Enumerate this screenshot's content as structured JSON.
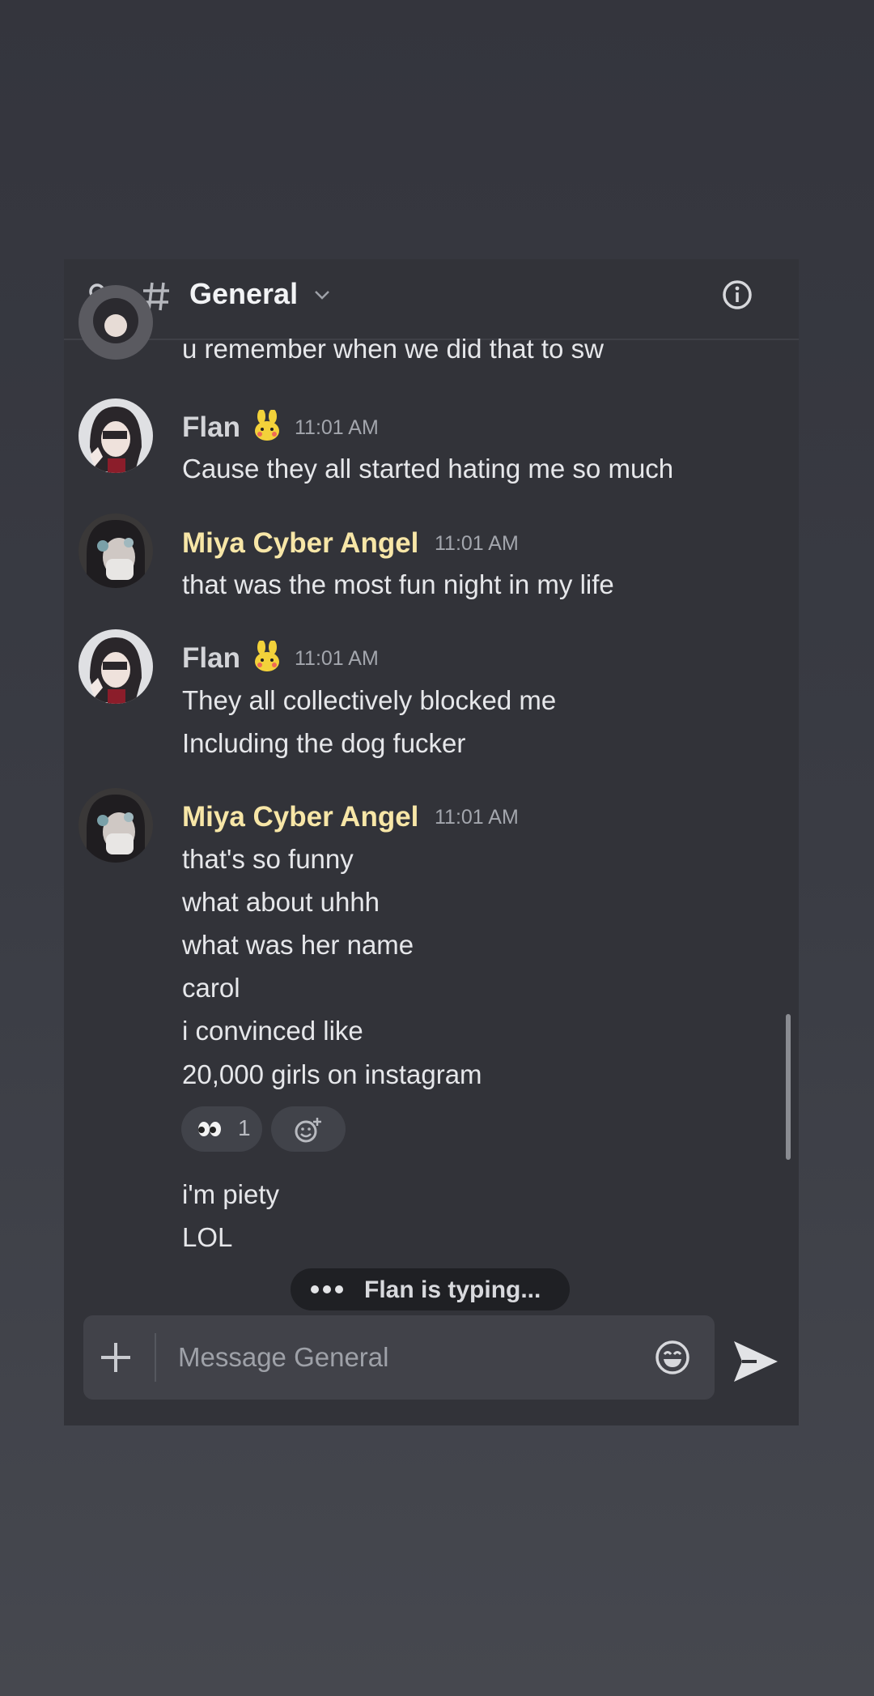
{
  "header": {
    "title": "General",
    "icons": [
      "members-icon",
      "hash-icon",
      "chevron-down-icon",
      "info-icon"
    ]
  },
  "colors": {
    "flan_name": "#d3d4d8",
    "miya_name": "#f7e6a7",
    "accent": "#f2f3f5"
  },
  "messages": {
    "partial_top": "u remember when we did that to sw",
    "m1": {
      "author": "Flan",
      "badge_icon": "bunny-emoji-icon",
      "time": "11:01 AM",
      "lines": [
        "Cause they all started hating me so much"
      ]
    },
    "m2": {
      "author": "Miya Cyber Angel",
      "time": "11:01 AM",
      "lines": [
        "that was the most fun night in my life"
      ]
    },
    "m3": {
      "author": "Flan",
      "badge_icon": "bunny-emoji-icon",
      "time": "11:01 AM",
      "lines": [
        "They all collectively blocked me",
        "Including the dog fucker"
      ]
    },
    "m4": {
      "author": "Miya Cyber Angel",
      "time": "11:01 AM",
      "lines": [
        "that's so funny",
        "what about uhhh",
        "what was her name",
        "carol",
        "i convinced like",
        "20,000 girls on instagram"
      ],
      "reaction": {
        "icon": "eyes-emoji-icon",
        "count": "1"
      },
      "after_lines": [
        "i'm piety",
        "LOL"
      ]
    }
  },
  "typing": "Flan is typing...",
  "composer": {
    "placeholder": "Message General",
    "icons": [
      "plus-icon",
      "emoji-icon",
      "send-icon"
    ]
  }
}
